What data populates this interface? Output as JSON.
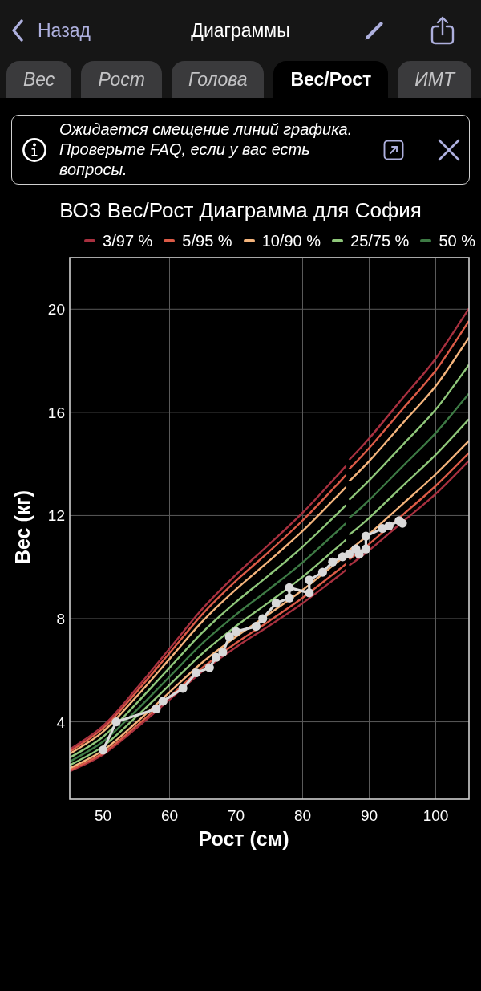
{
  "nav": {
    "back": "Назад",
    "title": "Диаграммы"
  },
  "tabs": [
    {
      "label": "Вес",
      "selected": false
    },
    {
      "label": "Рост",
      "selected": false
    },
    {
      "label": "Голова",
      "selected": false
    },
    {
      "label": "Вес/Рост",
      "selected": true
    },
    {
      "label": "ИМТ",
      "selected": false
    }
  ],
  "notice": {
    "text": "Ожидается смещение линий графика. Проверьте FAQ, если у вас есть вопросы."
  },
  "chart": {
    "chart_data": {
      "type": "line",
      "title": "ВОЗ Вес/Рост Диаграмма для София",
      "xlabel": "Рост (см)",
      "ylabel": "Вес (кг)",
      "xlim": [
        45,
        105
      ],
      "ylim": [
        1,
        22
      ],
      "xticks": [
        50,
        60,
        70,
        80,
        90,
        100
      ],
      "yticks": [
        4,
        8,
        12,
        16,
        20
      ],
      "grid": true,
      "legend": true,
      "x": [
        45,
        50,
        55,
        60,
        65,
        70,
        75,
        80,
        85,
        86.5
      ],
      "series": [
        {
          "name": "3/97 %",
          "color": "#a8303f",
          "values": [
            2.08,
            2.73,
            3.75,
            4.86,
            5.97,
            6.9,
            7.73,
            8.6,
            9.58,
            9.89
          ]
        },
        {
          "name": "5/95 %",
          "color": "#dc5b47",
          "values": [
            2.13,
            2.79,
            3.84,
            4.97,
            6.11,
            7.06,
            7.91,
            8.81,
            9.81,
            10.12
          ]
        },
        {
          "name": "10/90 %",
          "color": "#f4b47c",
          "values": [
            2.2,
            2.89,
            3.97,
            5.15,
            6.32,
            7.3,
            8.19,
            9.11,
            10.15,
            10.47
          ]
        },
        {
          "name": "25/75 %",
          "color": "#8fc77a",
          "values": [
            2.32,
            3.05,
            4.2,
            5.43,
            6.67,
            7.71,
            8.65,
            9.62,
            10.72,
            11.06
          ]
        },
        {
          "name": "50 %",
          "color": "#3d7a44",
          "values": [
            2.46,
            3.23,
            4.44,
            5.75,
            7.06,
            8.16,
            9.15,
            10.18,
            11.34,
            11.7
          ]
        },
        {
          "color": "#8fc77a",
          "values": [
            2.61,
            3.42,
            4.71,
            6.1,
            7.48,
            8.65,
            9.7,
            10.79,
            12.02,
            12.4
          ]
        },
        {
          "color": "#f4b47c",
          "values": [
            2.76,
            3.62,
            4.97,
            6.44,
            7.91,
            9.14,
            10.25,
            11.4,
            12.7,
            13.1
          ]
        },
        {
          "color": "#dc5b47",
          "values": [
            2.85,
            3.75,
            5.15,
            6.67,
            8.19,
            9.47,
            10.61,
            11.81,
            13.15,
            13.57
          ]
        },
        {
          "color": "#a8303f",
          "values": [
            2.93,
            3.84,
            5.28,
            6.84,
            8.4,
            9.71,
            10.89,
            12.11,
            13.49,
            13.92
          ]
        },
        {
          "color": "#a8303f",
          "x": [
            87,
            90,
            95,
            100,
            105
          ],
          "values": [
            10.06,
            10.65,
            11.75,
            12.84,
            14.13
          ]
        },
        {
          "color": "#dc5b47",
          "x": [
            87,
            90,
            95,
            100,
            105
          ],
          "values": [
            10.29,
            10.9,
            12.02,
            13.15,
            14.43
          ]
        },
        {
          "color": "#f4b47c",
          "x": [
            87,
            90,
            95,
            100,
            105
          ],
          "values": [
            10.65,
            11.28,
            12.44,
            13.6,
            14.9
          ]
        },
        {
          "color": "#8fc77a",
          "x": [
            87,
            90,
            95,
            100,
            105
          ],
          "values": [
            11.25,
            11.91,
            13.14,
            14.36,
            15.74
          ]
        },
        {
          "color": "#3d7a44",
          "x": [
            87,
            90,
            95,
            100,
            105
          ],
          "values": [
            11.9,
            12.6,
            13.9,
            15.2,
            16.73
          ]
        },
        {
          "color": "#8fc77a",
          "x": [
            87,
            90,
            95,
            100,
            105
          ],
          "values": [
            12.61,
            13.36,
            14.73,
            16.11,
            17.85
          ]
        },
        {
          "color": "#f4b47c",
          "x": [
            87,
            90,
            95,
            100,
            105
          ],
          "values": [
            13.33,
            14.11,
            15.57,
            17.02,
            18.9
          ]
        },
        {
          "color": "#dc5b47",
          "x": [
            87,
            90,
            95,
            100,
            105
          ],
          "values": [
            13.8,
            14.62,
            16.12,
            17.63,
            19.55
          ]
        },
        {
          "color": "#a8303f",
          "x": [
            87,
            90,
            95,
            100,
            105
          ],
          "values": [
            14.16,
            14.99,
            16.54,
            18.09,
            20.03
          ]
        },
        {
          "color": "#d9d9d9",
          "marker": "circle",
          "x": [
            50,
            52,
            58,
            59,
            62,
            64,
            66,
            67,
            68,
            69,
            70,
            73,
            74,
            76,
            78,
            78,
            81,
            81,
            83,
            84.5,
            86,
            87,
            88,
            88.5,
            89.5,
            89.5,
            92,
            93,
            94.5,
            95
          ],
          "values": [
            2.9,
            4.0,
            4.5,
            4.8,
            5.3,
            5.9,
            6.1,
            6.5,
            6.7,
            7.3,
            7.5,
            7.7,
            8.0,
            8.6,
            8.8,
            9.2,
            9.0,
            9.5,
            9.8,
            10.2,
            10.4,
            10.5,
            10.7,
            10.5,
            10.7,
            11.2,
            11.5,
            11.6,
            11.8,
            11.7
          ]
        }
      ]
    }
  }
}
